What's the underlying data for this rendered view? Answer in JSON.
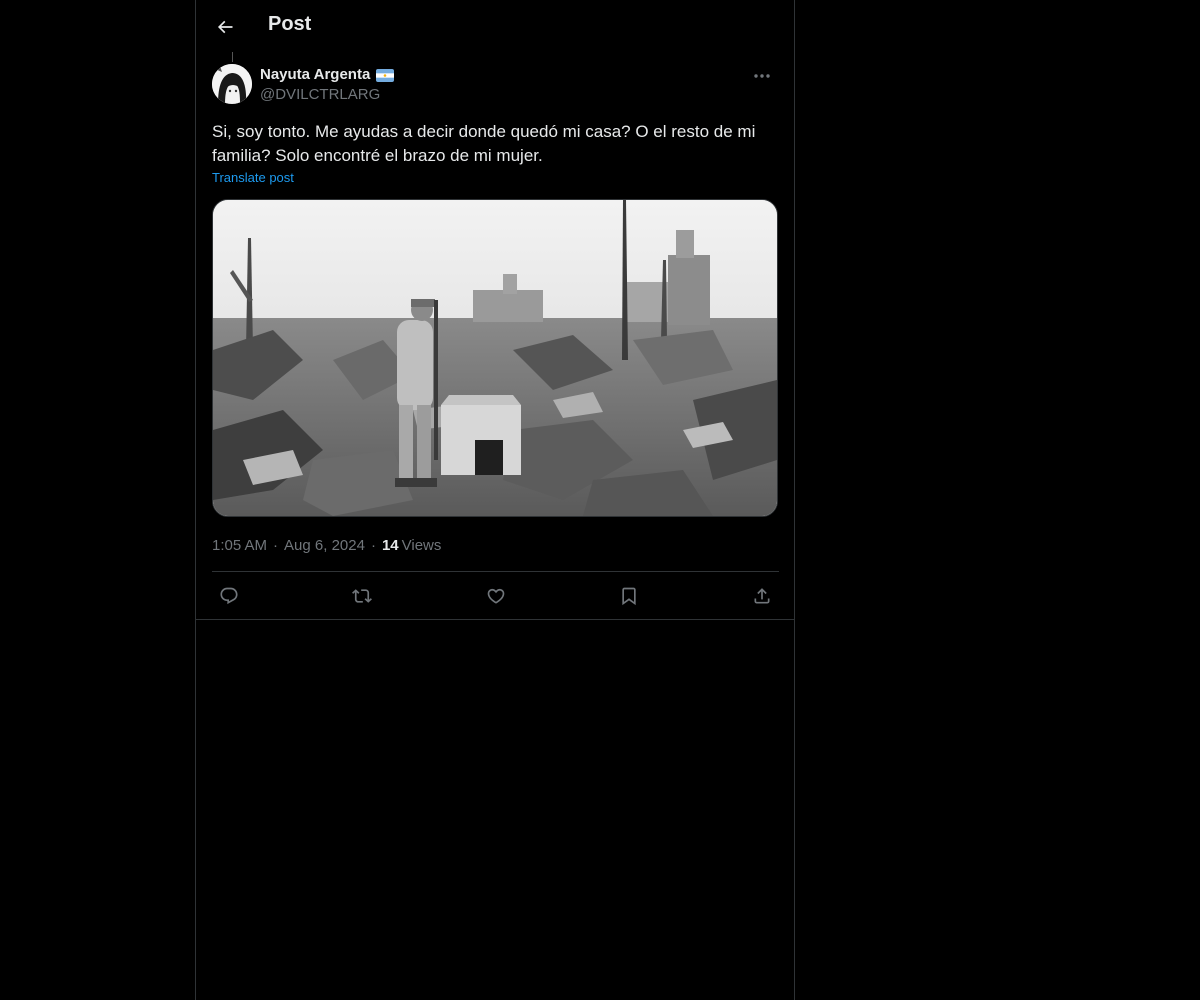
{
  "header": {
    "title": "Post",
    "back_icon": "arrow-left-icon"
  },
  "post": {
    "author": {
      "display_name": "Nayuta Argenta",
      "flag_icon": "argentina-flag-icon",
      "handle": "@DVILCTRLARG"
    },
    "text": "Si, soy tonto. Me ayudas a decir donde quedó mi casa? O el resto de mi familia? Solo encontré el brazo de mi mujer.",
    "translate_label": "Translate post",
    "time": "1:05 AM",
    "date": "Aug 6, 2024",
    "separator": "·",
    "views_count": "14",
    "views_label": "Views"
  },
  "actions": [
    {
      "name": "reply",
      "icon": "reply-icon"
    },
    {
      "name": "repost",
      "icon": "repost-icon"
    },
    {
      "name": "like",
      "icon": "heart-icon"
    },
    {
      "name": "bookmark",
      "icon": "bookmark-icon"
    },
    {
      "name": "share",
      "icon": "share-icon"
    }
  ],
  "colors": {
    "background": "#000000",
    "text": "#e7e9ea",
    "secondary_text": "#71767b",
    "link": "#1d9bf0",
    "border": "#2f3336"
  }
}
